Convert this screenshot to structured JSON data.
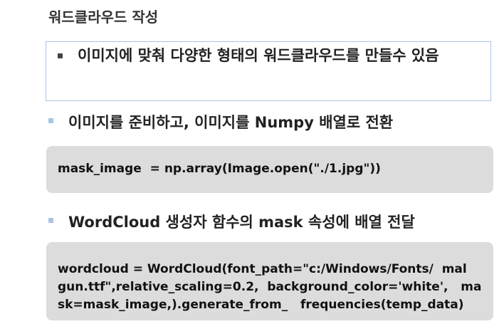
{
  "title": "워드클라우드 작성",
  "box": {
    "text": "이미지에 맞춰 다양한 형태의 워드클라우드를 만들수 있음"
  },
  "step1": {
    "text": "이미지를 준비하고, 이미지를 Numpy 배열로 전환",
    "code": "mask_image  = np.array(Image.open(\"./1.jpg\"))"
  },
  "step2": {
    "text": "WordCloud 생성자 함수의 mask 속성에 배열 전달",
    "code_lines": [
      "wordcloud = WordCloud(font_path=\"c:/Windows/Fonts/  mal",
      "gun.ttf\",relative_scaling=0.2,  background_color='white',   ma",
      "sk=mask_image,).generate_from_   frequencies(temp_data)"
    ]
  }
}
